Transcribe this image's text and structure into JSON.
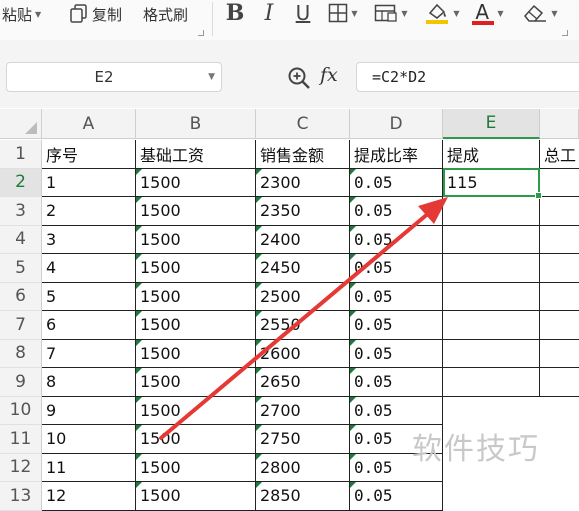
{
  "toolbar": {
    "paste_label": "粘贴",
    "copy_label": "复制",
    "format_painter_label": "格式刷",
    "icons": [
      "paste-dropdown",
      "copy-icon",
      "bold-icon",
      "italic-icon",
      "underline-icon",
      "borders-icon",
      "cell-style-icon",
      "fill-color-icon",
      "font-color-icon",
      "clear-icon"
    ],
    "bold": "B",
    "italic": "I",
    "underline": "U",
    "font_color_letter": "A",
    "colors": {
      "fill_bar": "#f3c400",
      "font_bar": "#e02020"
    }
  },
  "formula_bar": {
    "name_box": "E2",
    "fx_label": "fx",
    "formula": "=C2*D2"
  },
  "sheet": {
    "columns": [
      "A",
      "B",
      "C",
      "D",
      "E"
    ],
    "active_column": "E",
    "active_row": "2",
    "headers": [
      "序号",
      "基础工资",
      "销售金额",
      "提成比率",
      "提成",
      "总工"
    ],
    "rows": [
      {
        "num": "2",
        "a": "1",
        "b": "1500",
        "c": "2300",
        "d": "0.05",
        "e": "115"
      },
      {
        "num": "3",
        "a": "2",
        "b": "1500",
        "c": "2350",
        "d": "0.05",
        "e": ""
      },
      {
        "num": "4",
        "a": "3",
        "b": "1500",
        "c": "2400",
        "d": "0.05",
        "e": ""
      },
      {
        "num": "5",
        "a": "4",
        "b": "1500",
        "c": "2450",
        "d": "0.05",
        "e": ""
      },
      {
        "num": "6",
        "a": "5",
        "b": "1500",
        "c": "2500",
        "d": "0.05",
        "e": ""
      },
      {
        "num": "7",
        "a": "6",
        "b": "1500",
        "c": "2550",
        "d": "0.05",
        "e": ""
      },
      {
        "num": "8",
        "a": "7",
        "b": "1500",
        "c": "2600",
        "d": "0.05",
        "e": ""
      },
      {
        "num": "9",
        "a": "8",
        "b": "1500",
        "c": "2650",
        "d": "0.05",
        "e": ""
      },
      {
        "num": "10",
        "a": "9",
        "b": "1500",
        "c": "2700",
        "d": "0.05",
        "e": ""
      },
      {
        "num": "11",
        "a": "10",
        "b": "1500",
        "c": "2750",
        "d": "0.05",
        "e": ""
      },
      {
        "num": "12",
        "a": "11",
        "b": "1500",
        "c": "2800",
        "d": "0.05",
        "e": ""
      },
      {
        "num": "13",
        "a": "12",
        "b": "1500",
        "c": "2850",
        "d": "0.05",
        "e": ""
      }
    ]
  },
  "annotation_color": "#e53935",
  "watermark": "软件技巧"
}
